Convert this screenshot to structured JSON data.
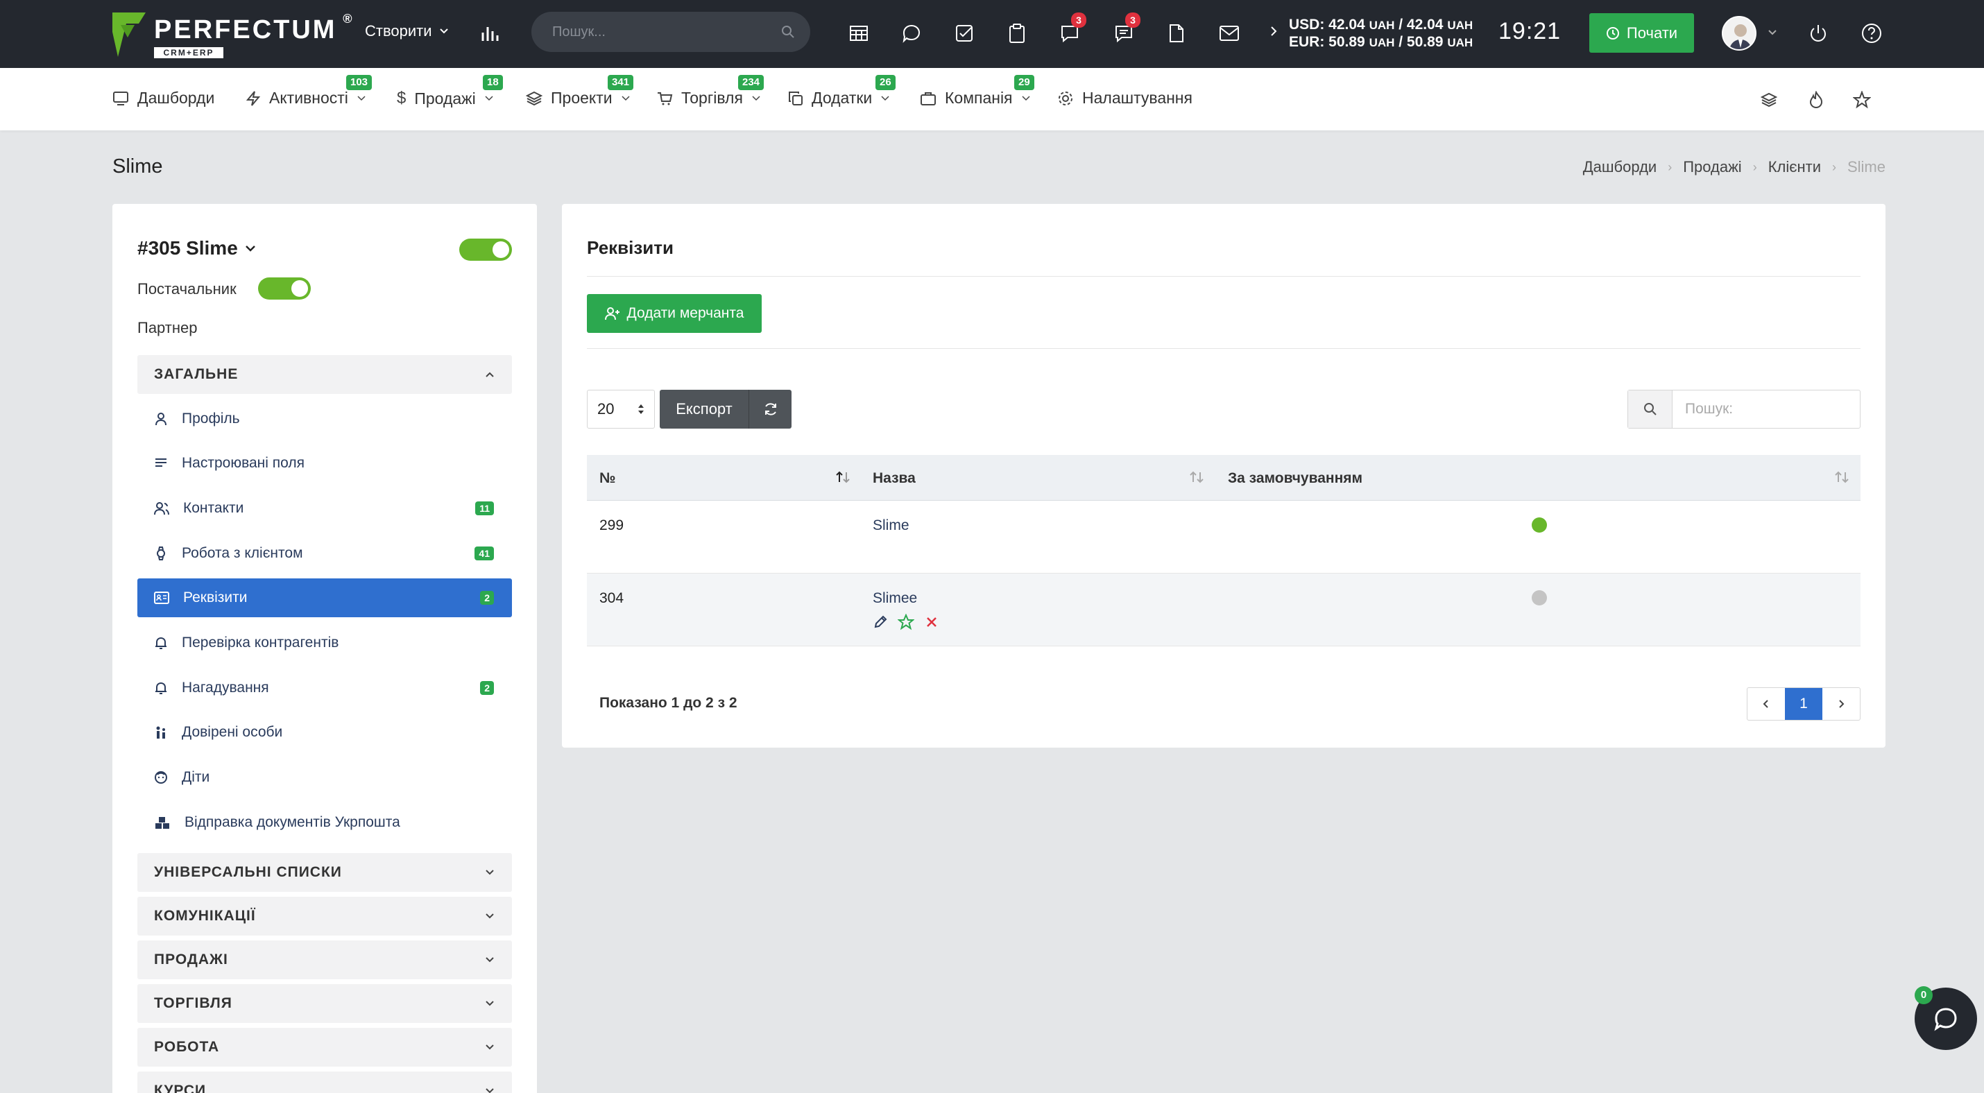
{
  "topbar": {
    "logo_text": "PERFECTUM",
    "logo_reg": "®",
    "logo_sub": "CRM+ERP",
    "create_label": "Створити",
    "search_placeholder": "Пошук...",
    "notif_badge_1": "3",
    "notif_badge_2": "3",
    "usd_line": "USD: 42.04",
    "usd_unit1": "UAH",
    "usd_mid": "/ 42.04",
    "usd_unit2": "UAH",
    "eur_line": "EUR: 50.89",
    "eur_unit1": "UAH",
    "eur_mid": "/ 50.89",
    "eur_unit2": "UAH",
    "clock": "19:21",
    "start_label": "Почати"
  },
  "nav": {
    "items": [
      {
        "label": "Дашборди",
        "badge": ""
      },
      {
        "label": "Активності",
        "badge": "103"
      },
      {
        "label": "Продажі",
        "badge": "18"
      },
      {
        "label": "Проекти",
        "badge": "341"
      },
      {
        "label": "Торгівля",
        "badge": "234"
      },
      {
        "label": "Додатки",
        "badge": "26"
      },
      {
        "label": "Компанія",
        "badge": "29"
      },
      {
        "label": "Налаштування",
        "badge": ""
      }
    ]
  },
  "page": {
    "title": "Slime",
    "breadcrumb": [
      "Дашборди",
      "Продажі",
      "Клієнти",
      "Slime"
    ]
  },
  "left": {
    "client_name": "#305 Slime",
    "supplier_label": "Постачальник",
    "partner_label": "Партнер",
    "general_section": "ЗАГАЛЬНЕ",
    "menu": [
      {
        "label": "Профіль",
        "badge": ""
      },
      {
        "label": "Настроювані поля",
        "badge": ""
      },
      {
        "label": "Контакти",
        "badge": "11"
      },
      {
        "label": "Робота з клієнтом",
        "badge": "41"
      },
      {
        "label": "Реквізити",
        "badge": "2"
      },
      {
        "label": "Перевірка контрагентів",
        "badge": ""
      },
      {
        "label": "Нагадування",
        "badge": "2"
      },
      {
        "label": "Довірені особи",
        "badge": ""
      },
      {
        "label": "Діти",
        "badge": ""
      },
      {
        "label": "Відправка документів Укрпошта",
        "badge": ""
      }
    ],
    "sections": [
      "УНІВЕРСАЛЬНІ СПИСКИ",
      "КОМУНІКАЦІЇ",
      "ПРОДАЖІ",
      "ТОРГІВЛЯ",
      "РОБОТА",
      "КУРСИ"
    ]
  },
  "main": {
    "title": "Реквізити",
    "add_button": "Додати мерчанта",
    "per_page": "20",
    "export_label": "Експорт",
    "search_placeholder": "Пошук:",
    "columns": [
      "№",
      "Назва",
      "За замовчуванням"
    ],
    "rows": [
      {
        "num": "299",
        "name": "Slime",
        "default": true
      },
      {
        "num": "304",
        "name": "Slimee",
        "default": false
      }
    ],
    "showing": "Показано 1 до 2 з 2",
    "current_page": "1"
  },
  "chat": {
    "badge": "0"
  },
  "colors": {
    "accent_green": "#2ca84f",
    "active_blue": "#2f6fcf",
    "topbar_dark": "#24282f",
    "badge_red": "#e0313e",
    "default_on": "#68b72b",
    "default_off": "#c4c4c4"
  }
}
